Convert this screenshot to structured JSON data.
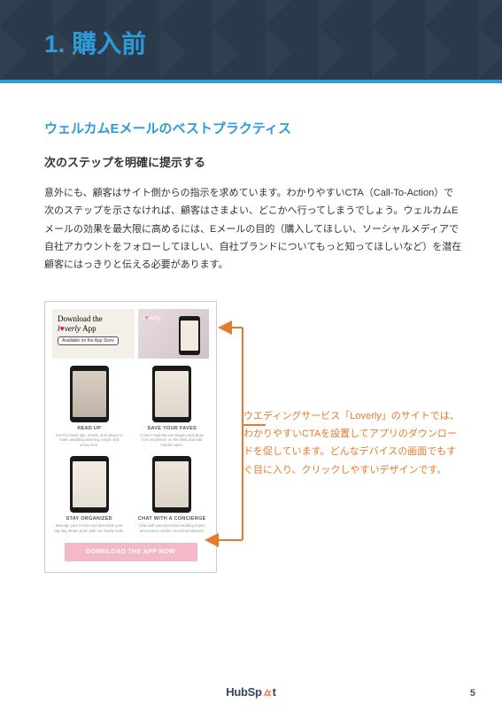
{
  "header": {
    "title": "1. 購入前"
  },
  "section": {
    "title": "ウェルカムEメールのベストプラクティス",
    "subtitle": "次のステップを明確に提示する",
    "body": "意外にも、顧客はサイト側からの指示を求めています。わかりやすいCTA（Call-To-Action）で次のステップを示さなければ、顧客はさまよい、どこかへ行ってしまうでしょう。ウェルカムEメールの効果を最大限に高めるには、Eメールの目的（購入してほしい、ソーシャルメディアで自社アカウントをフォローしてほしい、自社ブランドについてもっと知ってほしいなど）を潜在顧客にはっきりと伝える必要があります。"
  },
  "example": {
    "hero_line1": "Download the",
    "hero_brand_pre": "l",
    "hero_brand_heart": "♥",
    "hero_brand_post": "verly",
    "hero_line2_suffix": " App",
    "appstore": "Available on the App Store",
    "phone_brand_pre": "l",
    "phone_brand_heart": "♥",
    "phone_brand_post": "verly",
    "cells": [
      {
        "cap": "READ UP",
        "sub": "Get the latest tips, trends, and advice to make wedding planning simple and stress-free."
      },
      {
        "cap": "SAVE YOUR FAVES",
        "sub": "Collect inspirational images and ideas from anywhere on the Web and add helpful notes."
      },
      {
        "cap": "STAY ORGANIZED",
        "sub": "Manage your to-dos and assemble your big-day dream team with our handy tools."
      },
      {
        "cap": "CHAT WITH A CONCIERGE",
        "sub": "Chat with your personal wedding expert and receive vendor recommendations."
      }
    ],
    "cta": "DOWNLOAD THE APP NOW"
  },
  "annotation": "ウエディングサービス「Loverly」のサイトでは、わかりやすいCTAを設置してアプリのダウンロードを促しています。どんなデバイスの画面でもすぐ目に入り、クリックしやすいデザインです。",
  "footer": {
    "logo_pre": "HubSp",
    "logo_post": "t",
    "page": "5"
  },
  "colors": {
    "accent": "#2e9bd6",
    "callout": "#e77a2b"
  }
}
